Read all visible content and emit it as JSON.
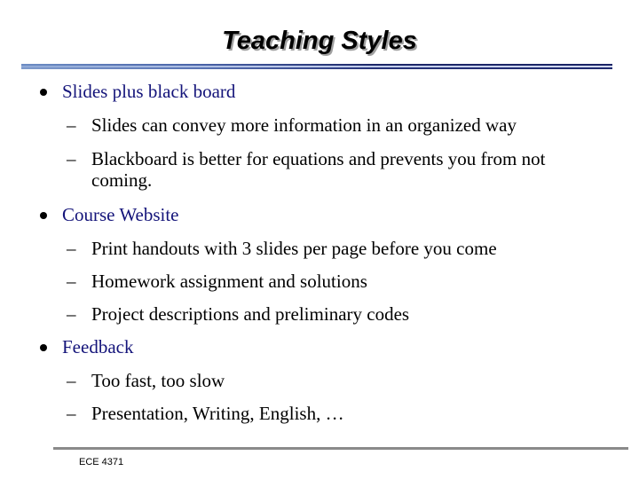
{
  "slide": {
    "title": "Teaching Styles",
    "bullet_icon": "filled-circle",
    "dash_icon": "en-dash",
    "dash_glyph": "–",
    "colors": {
      "level1_text": "#14147a",
      "level2_text": "#000000",
      "title_text": "#000000",
      "title_shadow": "#a0a0a0",
      "rule_dark": "#1c2768",
      "rule_light": "#d2d9f0",
      "footer_rule": "#8a8a8a"
    },
    "bullets": [
      {
        "text": "Slides plus black board",
        "sub": [
          "Slides can convey more information in an organized way",
          "Blackboard is better for equations and prevents you from not coming."
        ]
      },
      {
        "text": "Course Website",
        "sub": [
          "Print handouts with 3 slides per page before you come",
          "Homework assignment and solutions",
          "Project descriptions and preliminary codes"
        ]
      },
      {
        "text": "Feedback",
        "sub": [
          "Too fast, too slow",
          "Presentation, Writing, English, …"
        ]
      }
    ],
    "footer": "ECE 4371"
  }
}
